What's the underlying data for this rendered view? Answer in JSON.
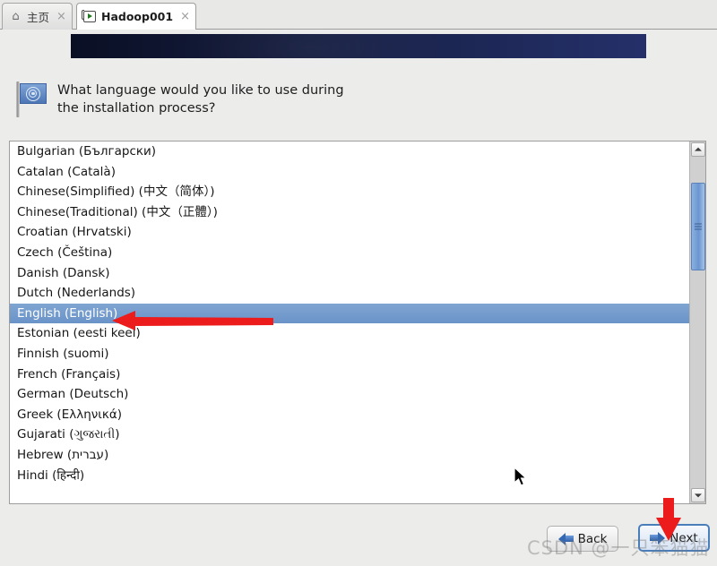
{
  "window": {
    "tabs": [
      {
        "label": "主页",
        "icon": "home-icon",
        "close": "×",
        "active": false
      },
      {
        "label": "Hadoop001",
        "icon": "terminal-icon",
        "close": "×",
        "active": true
      }
    ]
  },
  "installer": {
    "question": "What language would you like to use during the installation process?",
    "flag_icon": "un-flag-icon",
    "banner_colors": {
      "from": "#0a0f24",
      "to": "#25306a"
    },
    "selection_color": "#6a93c8",
    "selected_language": "English (English)",
    "languages": [
      "Bulgarian (Български)",
      "Catalan (Català)",
      "Chinese(Simplified) (中文（简体）)",
      "Chinese(Traditional) (中文（正體）)",
      "Croatian (Hrvatski)",
      "Czech (Čeština)",
      "Danish (Dansk)",
      "Dutch (Nederlands)",
      "English (English)",
      "Estonian (eesti keel)",
      "Finnish (suomi)",
      "French (Français)",
      "German (Deutsch)",
      "Greek (Ελληνικά)",
      "Gujarati (ગુજરાતી)",
      "Hebrew (עברית)",
      "Hindi (हिन्दी)"
    ],
    "scrollbar": {
      "up_arrow": "scroll-up-icon",
      "down_arrow": "scroll-down-icon"
    },
    "buttons": {
      "back": "Back",
      "next": "Next"
    }
  },
  "annotations": {
    "arrow_color": "#ec1c1c",
    "pointing_at_selection": "English (English)",
    "pointing_at_button": "Next"
  },
  "watermark": "CSDN @一只笨猫猫"
}
